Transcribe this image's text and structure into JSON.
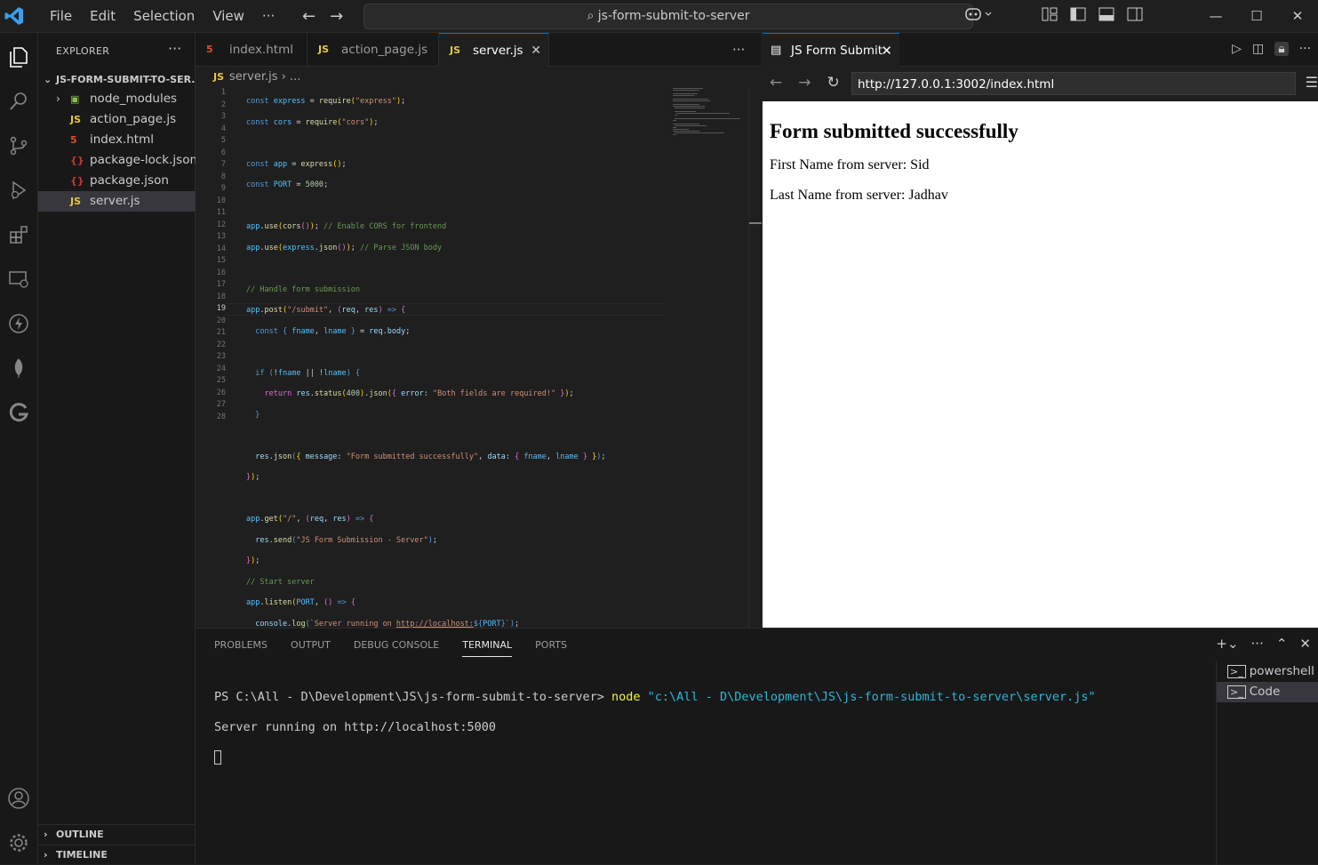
{
  "titlebar": {
    "menu": [
      "File",
      "Edit",
      "Selection",
      "View",
      "···"
    ],
    "search": "js-form-submit-to-server",
    "window_controls": [
      "minimize-icon",
      "maximize-icon",
      "close-icon"
    ]
  },
  "explorer": {
    "title": "EXPLORER",
    "project": "JS-FORM-SUBMIT-TO-SER...",
    "files": [
      {
        "name": "node_modules",
        "icon": "folder-icon",
        "type": "folder"
      },
      {
        "name": "action_page.js",
        "icon": "JS",
        "type": "js"
      },
      {
        "name": "index.html",
        "icon": "5",
        "type": "html"
      },
      {
        "name": "package-lock.json",
        "icon": "{}",
        "type": "json"
      },
      {
        "name": "package.json",
        "icon": "{}",
        "type": "json"
      },
      {
        "name": "server.js",
        "icon": "JS",
        "type": "js",
        "selected": true
      }
    ],
    "outline": "OUTLINE",
    "timeline": "TIMELINE"
  },
  "editor_tabs": [
    {
      "label": "index.html",
      "icon": "5"
    },
    {
      "label": "action_page.js",
      "icon": "JS"
    },
    {
      "label": "server.js",
      "icon": "JS",
      "active": true
    }
  ],
  "breadcrumb": {
    "file": "server.js",
    "rest": "..."
  },
  "code_lines": [
    "1",
    "2",
    "3",
    "4",
    "5",
    "6",
    "7",
    "8",
    "9",
    "10",
    "11",
    "12",
    "13",
    "14",
    "15",
    "16",
    "17",
    "18",
    "19",
    "20",
    "21",
    "22",
    "23",
    "24",
    "25",
    "26",
    "27",
    "28"
  ],
  "current_line": "19",
  "browser": {
    "tab_title": "JS Form Submit",
    "url": "http://127.0.0.1:3002/index.html",
    "heading": "Form submitted successfully",
    "first_name": "First Name from server: Sid",
    "last_name": "Last Name from server: Jadhav"
  },
  "panel": {
    "tabs": [
      "PROBLEMS",
      "OUTPUT",
      "DEBUG CONSOLE",
      "TERMINAL",
      "PORTS"
    ],
    "active_tab": "TERMINAL",
    "prompt": "PS C:\\All - D\\Development\\JS\\js-form-submit-to-server> ",
    "command": "node",
    "arg": " \"c:\\All - D\\Development\\JS\\js-form-submit-to-server\\server.js\"",
    "output": "Server running on http://localhost:5000",
    "terminals": [
      "powershell",
      "Code"
    ]
  },
  "colors": {
    "accent": "#0078d4",
    "js_icon": "#e8c83e",
    "html_icon": "#e44d26",
    "json_icon": "#cb3837"
  }
}
